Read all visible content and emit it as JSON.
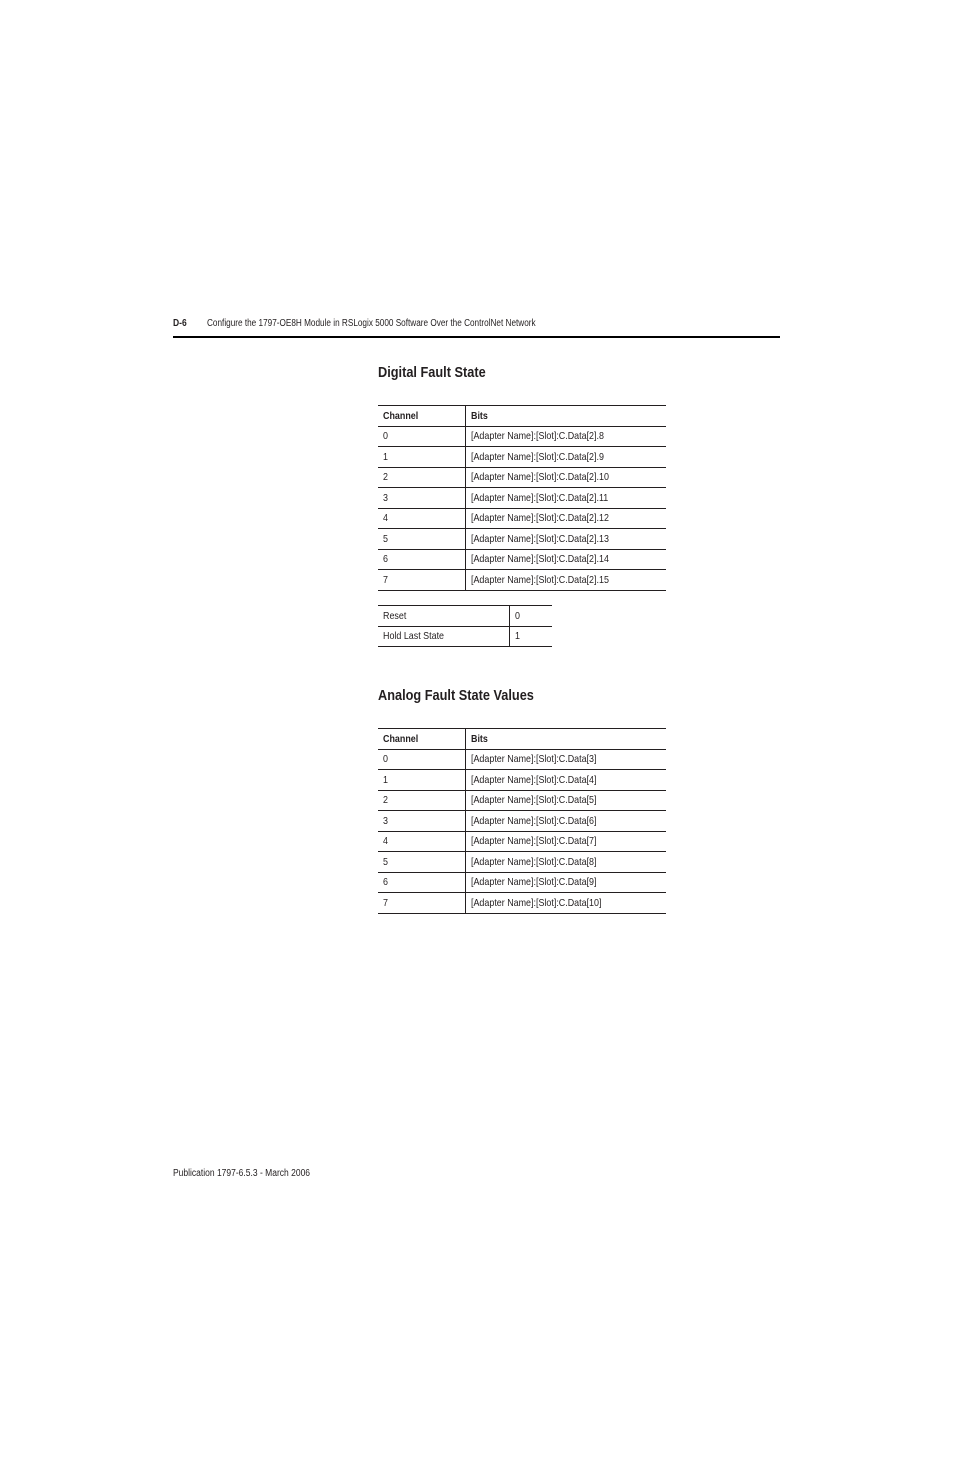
{
  "header": {
    "page_number": "D-6",
    "running_title": "Configure the 1797-OE8H Module in RSLogix 5000 Software Over the ControlNet Network"
  },
  "digital_fault_state": {
    "title": "Digital Fault State",
    "columns": [
      "Channel",
      "Bits"
    ],
    "rows": [
      [
        "0",
        "[Adapter Name]:[Slot]:C.Data[2].8"
      ],
      [
        "1",
        "[Adapter Name]:[Slot]:C.Data[2].9"
      ],
      [
        "2",
        "[Adapter Name]:[Slot]:C.Data[2].10"
      ],
      [
        "3",
        "[Adapter Name]:[Slot]:C.Data[2].11"
      ],
      [
        "4",
        "[Adapter Name]:[Slot]:C.Data[2].12"
      ],
      [
        "5",
        "[Adapter Name]:[Slot]:C.Data[2].13"
      ],
      [
        "6",
        "[Adapter Name]:[Slot]:C.Data[2].14"
      ],
      [
        "7",
        "[Adapter Name]:[Slot]:C.Data[2].15"
      ]
    ],
    "state_values": [
      [
        "Reset",
        "0"
      ],
      [
        "Hold Last State",
        "1"
      ]
    ]
  },
  "analog_fault_state_values": {
    "title": "Analog Fault State Values",
    "columns": [
      "Channel",
      "Bits"
    ],
    "rows": [
      [
        "0",
        "[Adapter Name]:[Slot]:C.Data[3]"
      ],
      [
        "1",
        "[Adapter Name]:[Slot]:C.Data[4]"
      ],
      [
        "2",
        "[Adapter Name]:[Slot]:C.Data[5]"
      ],
      [
        "3",
        "[Adapter Name]:[Slot]:C.Data[6]"
      ],
      [
        "4",
        "[Adapter Name]:[Slot]:C.Data[7]"
      ],
      [
        "5",
        "[Adapter Name]:[Slot]:C.Data[8]"
      ],
      [
        "6",
        "[Adapter Name]:[Slot]:C.Data[9]"
      ],
      [
        "7",
        "[Adapter Name]:[Slot]:C.Data[10]"
      ]
    ]
  },
  "footer": {
    "publication": "Publication 1797-6.5.3 - March 2006"
  }
}
